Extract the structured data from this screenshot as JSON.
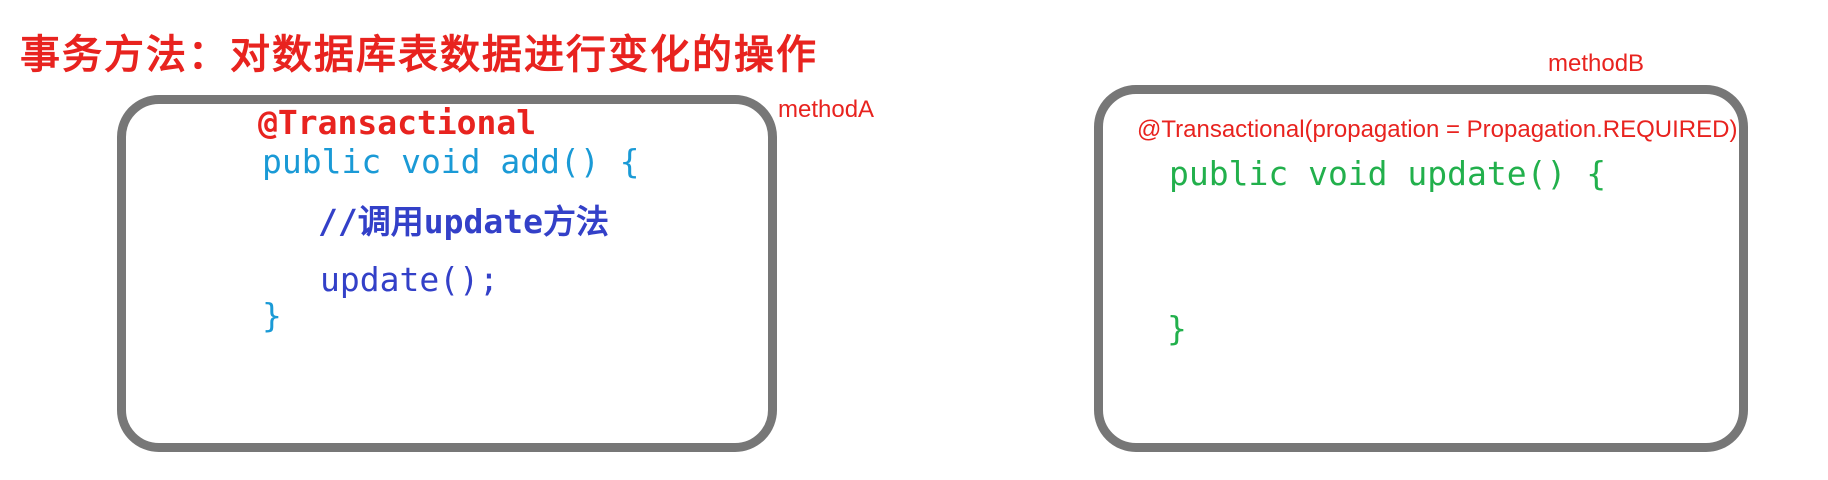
{
  "title": "事务方法：对数据库表数据进行变化的操作",
  "method_a": {
    "label": "methodA",
    "annotation": "@Transactional",
    "signature": "public void add() {",
    "comment": "//调用update方法",
    "call": "update();",
    "close": "}"
  },
  "method_b": {
    "label": "methodB",
    "annotation": "@Transactional(propagation = Propagation.REQUIRED)",
    "signature": "public void update() {",
    "close": "}"
  },
  "colors": {
    "title": "#e8231f",
    "annotation": "#e8231f",
    "label": "#e8231f",
    "method_a_code": "#1a9ad6",
    "method_a_body": "#3340c8",
    "method_b_code": "#22b04c",
    "border": "#777777"
  }
}
